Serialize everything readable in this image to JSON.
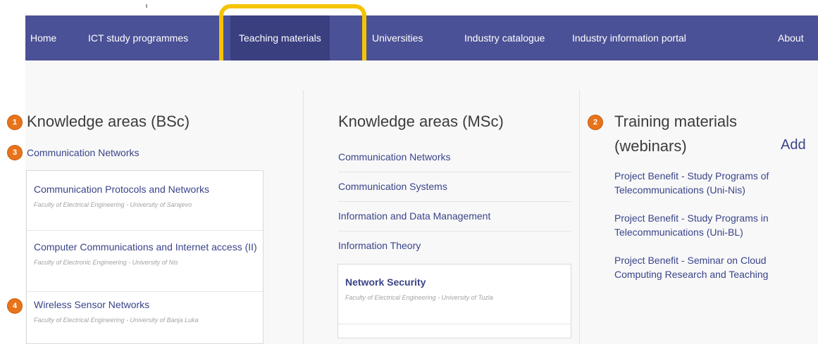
{
  "nav": {
    "items": [
      {
        "label": "Home"
      },
      {
        "label": "ICT study programmes"
      },
      {
        "label": "Teaching materials",
        "active": true
      },
      {
        "label": "Universities"
      },
      {
        "label": "Industry catalogue"
      },
      {
        "label": "Industry information portal"
      },
      {
        "label": "About"
      }
    ]
  },
  "badges": {
    "b1": "1",
    "b2": "2",
    "b3": "3",
    "b4": "4"
  },
  "bsc": {
    "heading": "Knowledge areas (BSc)",
    "section": "Communication Networks",
    "courses": [
      {
        "title": "Communication Protocols and Networks",
        "faculty": "Faculty of Electrical Engineering - University of Sarajevo"
      },
      {
        "title": "Computer Communications and Internet access (II)",
        "faculty": "Faculty of Electronic Engineering - University of Nis"
      },
      {
        "title": "Wireless Sensor Networks",
        "faculty": "Faculty of Electrical Engineering - University of Banja Luka"
      }
    ]
  },
  "msc": {
    "heading": "Knowledge areas (MSc)",
    "sections": [
      "Communication Networks",
      "Communication Systems",
      "Information and Data Management",
      "Information Theory"
    ],
    "course": {
      "title": "Network Security",
      "faculty": "Faculty of Electrical Engineering - University of Tuzla"
    }
  },
  "training": {
    "heading_line1": "Training materials",
    "heading_line2": "(webinars)",
    "add_label": "Add",
    "items": [
      "Project Benefit - Study Programs of Telecommunications (Uni-Nis)",
      "Project Benefit - Study Programs in Telecommunications (Uni-BL)",
      "Project Benefit - Seminar on Cloud Computing Research and Teaching"
    ]
  },
  "colors": {
    "nav_bg": "#4b5196",
    "highlight": "#f5c300",
    "badge": "#e8731a",
    "link": "#3a4488"
  }
}
